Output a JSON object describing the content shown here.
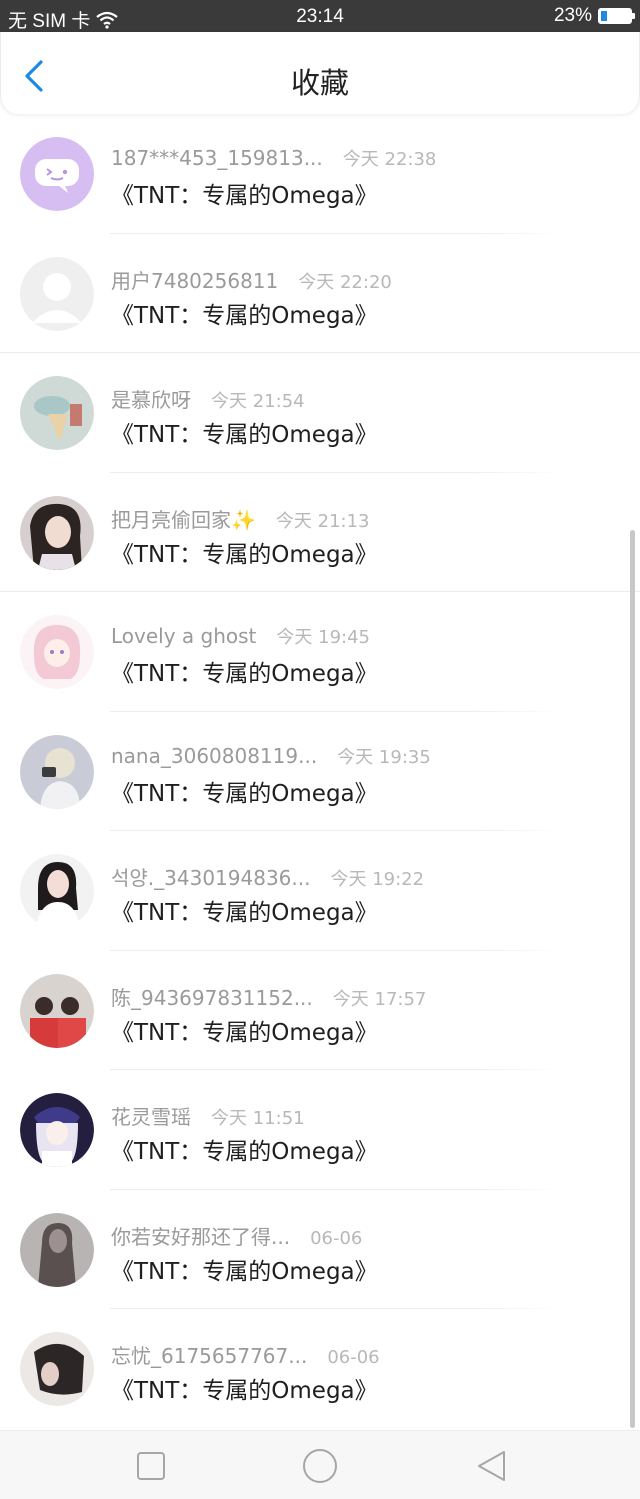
{
  "status_bar": {
    "carrier": "无 SIM 卡",
    "time": "23:14",
    "battery": "23%",
    "battery_level": 0.23,
    "wifi_icon": "wifi-icon"
  },
  "header": {
    "title": "收藏",
    "back_icon": "chevron-left-icon",
    "accent": "#1e88e5"
  },
  "items": [
    {
      "username": "187***453_159813...",
      "time": "今天 22:38",
      "title": "《TNT：专属的Omega》",
      "avatar": "chat-bubble-avatar"
    },
    {
      "username": "用户7480256811",
      "time": "今天 22:20",
      "title": "《TNT：专属的Omega》",
      "avatar": "default-avatar"
    },
    {
      "username": "是慕欣呀",
      "time": "今天 21:54",
      "title": "《TNT：专属的Omega》",
      "avatar": "photo-avatar"
    },
    {
      "username": "把月亮偷回家✨",
      "time": "今天 21:13",
      "title": "《TNT：专属的Omega》",
      "avatar": "photo-avatar"
    },
    {
      "username": "Lovely a ghost",
      "time": "今天 19:45",
      "title": "《TNT：专属的Omega》",
      "avatar": "anime-avatar"
    },
    {
      "username": "nana_3060808119...",
      "time": "今天 19:35",
      "title": "《TNT：专属的Omega》",
      "avatar": "photo-avatar"
    },
    {
      "username": "석양._3430194836...",
      "time": "今天 19:22",
      "title": "《TNT：专属的Omega》",
      "avatar": "photo-avatar"
    },
    {
      "username": "陈_943697831152...",
      "time": "今天 17:57",
      "title": "《TNT：专属的Omega》",
      "avatar": "photo-avatar"
    },
    {
      "username": "花灵雪瑶",
      "time": "今天 11:51",
      "title": "《TNT：专属的Omega》",
      "avatar": "anime-avatar"
    },
    {
      "username": "你若安好那还了得...",
      "time": "06-06",
      "title": "《TNT：专属的Omega》",
      "avatar": "photo-avatar"
    },
    {
      "username": "忘忧_6175657767...",
      "time": "06-06",
      "title": "《TNT：专属的Omega》",
      "avatar": "photo-avatar"
    }
  ],
  "nav_bar": {
    "recents_icon": "square-icon",
    "home_icon": "circle-icon",
    "back_icon": "triangle-back-icon"
  }
}
